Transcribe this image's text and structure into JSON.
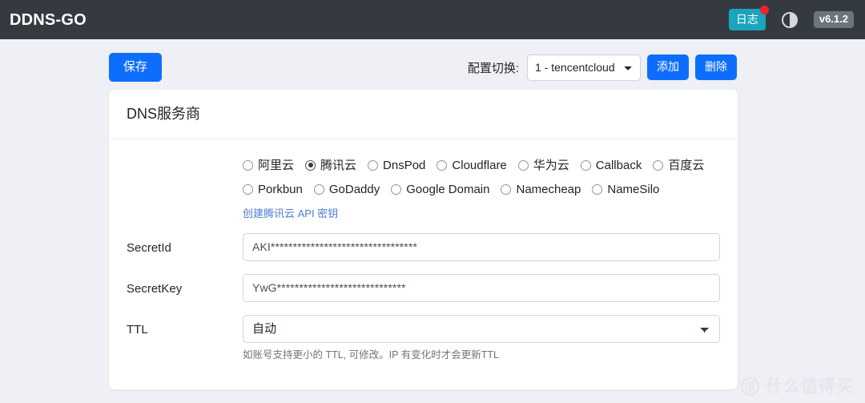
{
  "navbar": {
    "brand": "DDNS-GO",
    "log_button": "日志",
    "theme_toggle_icon": "half-circle-contrast-icon",
    "version": "v6.1.2",
    "badge_dot": true,
    "background_color": "#343a40",
    "log_button_color": "#1aa5bd",
    "badge_color": "#f5222d"
  },
  "toolbar": {
    "save_label": "保存",
    "config_switch_label": "配置切换:",
    "config_selected": "1 - tencentcloud",
    "config_options": [
      "1 - tencentcloud"
    ],
    "add_label": "添加",
    "delete_label": "删除",
    "primary_color": "#0d6efd"
  },
  "card": {
    "title": "DNS服务商",
    "providers_row1": [
      {
        "label": "阿里云",
        "checked": false
      },
      {
        "label": "腾讯云",
        "checked": true
      },
      {
        "label": "DnsPod",
        "checked": false
      },
      {
        "label": "Cloudflare",
        "checked": false
      },
      {
        "label": "华为云",
        "checked": false
      },
      {
        "label": "Callback",
        "checked": false
      },
      {
        "label": "百度云",
        "checked": false
      }
    ],
    "providers_row2": [
      {
        "label": "Porkbun",
        "checked": false
      },
      {
        "label": "GoDaddy",
        "checked": false
      },
      {
        "label": "Google Domain",
        "checked": false
      },
      {
        "label": "Namecheap",
        "checked": false
      },
      {
        "label": "NameSilo",
        "checked": false
      }
    ],
    "api_link": "创建腾讯云 API 密钥",
    "fields": {
      "secret_id_label": "SecretId",
      "secret_id_value": "AKI*********************************",
      "secret_key_label": "SecretKey",
      "secret_key_value": "YwG*****************************",
      "ttl_label": "TTL",
      "ttl_selected": "自动",
      "ttl_options": [
        "自动"
      ],
      "ttl_hint": "如账号支持更小的 TTL, 可修改。IP 有变化时才会更新TTL"
    }
  },
  "watermark": {
    "logo_char": "值",
    "text": "什么值得买"
  }
}
